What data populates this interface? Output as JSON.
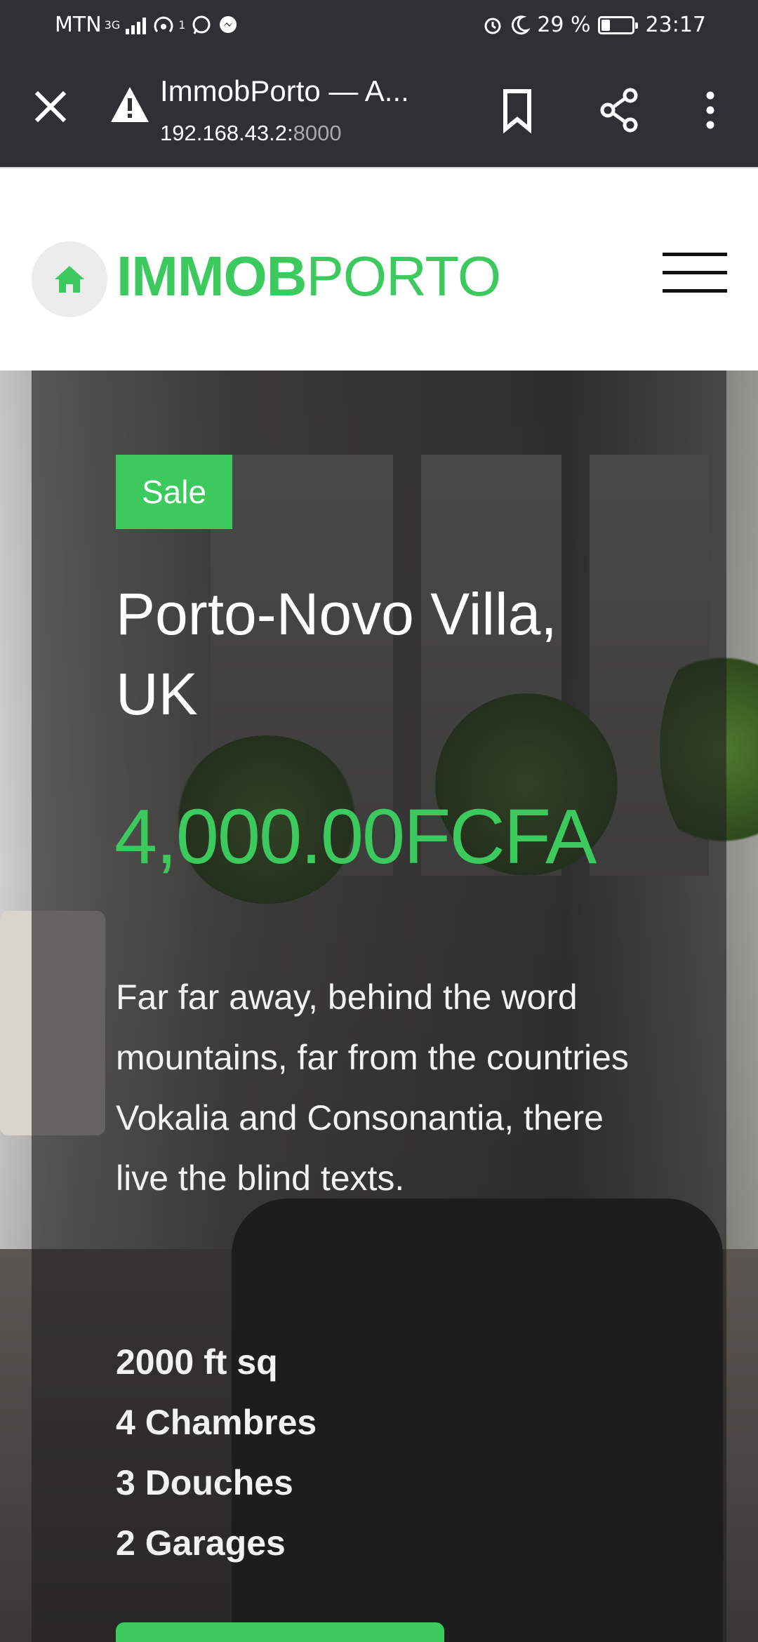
{
  "status_bar": {
    "carrier": "MTN",
    "network": "3G",
    "hotspot_sup": "1",
    "battery": "29 %",
    "battery_level": 0.29,
    "time": "23:17"
  },
  "browser": {
    "tab_title": "ImmobPorto — A...",
    "url_host": "192.168.43.2:",
    "url_port": "8000"
  },
  "site": {
    "brand_bold": "IMMOB",
    "brand_light": "PORTO"
  },
  "listing": {
    "badge": "Sale",
    "title": "Porto-Novo Villa, UK",
    "price": "4,000.00FCFA",
    "description": "Far far away, behind the word mountains, far from the countries Vokalia and Consonantia, there live the blind texts.",
    "features": [
      "2000 ft sq",
      "4 Chambres",
      "3 Douches",
      "2 Garages"
    ]
  },
  "colors": {
    "accent": "#3cc95e",
    "toolbar": "#2f3033"
  }
}
